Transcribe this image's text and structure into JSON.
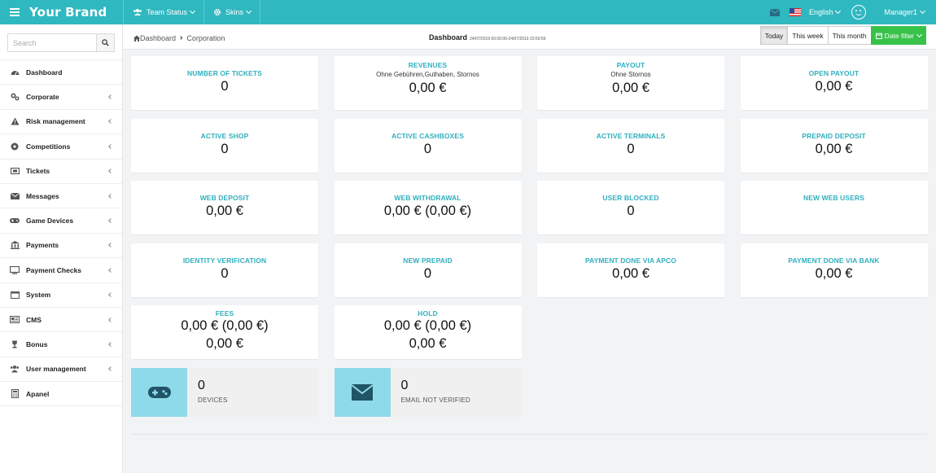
{
  "topbar": {
    "brand": "Your Brand",
    "menu": [
      {
        "label": "Team Status",
        "icon": "users-icon"
      },
      {
        "label": "Skins",
        "icon": "gear-icon"
      }
    ],
    "language": "English",
    "user": "Manager1"
  },
  "sidebar": {
    "search_placeholder": "Search",
    "items": [
      {
        "label": "Dashboard",
        "icon": "dashboard-icon",
        "has_children": false
      },
      {
        "label": "Corporate",
        "icon": "cogs-icon",
        "has_children": true
      },
      {
        "label": "Risk management",
        "icon": "warning-icon",
        "has_children": true
      },
      {
        "label": "Competitions",
        "icon": "ball-icon",
        "has_children": true
      },
      {
        "label": "Tickets",
        "icon": "ticket-icon",
        "has_children": true
      },
      {
        "label": "Messages",
        "icon": "envelope-icon",
        "has_children": true
      },
      {
        "label": "Game Devices",
        "icon": "gamepad-icon",
        "has_children": true
      },
      {
        "label": "Payments",
        "icon": "bank-icon",
        "has_children": true
      },
      {
        "label": "Payment Checks",
        "icon": "monitor-icon",
        "has_children": true
      },
      {
        "label": "System",
        "icon": "window-icon",
        "has_children": true
      },
      {
        "label": "CMS",
        "icon": "newspaper-icon",
        "has_children": true
      },
      {
        "label": "Bonus",
        "icon": "trophy-icon",
        "has_children": true
      },
      {
        "label": "User management",
        "icon": "users-icon",
        "has_children": true
      },
      {
        "label": "Apanel",
        "icon": "calculator-icon",
        "has_children": false
      }
    ]
  },
  "header": {
    "breadcrumb": [
      "Dashboard",
      "Corporation"
    ],
    "title": "Dashboard",
    "range": "24/07/2019 00:00:00-24/07/2019 23:59:59",
    "buttons": {
      "today": "Today",
      "week": "This week",
      "month": "This month",
      "filter": "Date filter"
    }
  },
  "cards": [
    {
      "title": "NUMBER OF TICKETS",
      "sub": "",
      "values": [
        "0"
      ]
    },
    {
      "title": "REVENUES",
      "sub": "Ohne Gebühren,Guthaben, Stornos",
      "values": [
        "0,00 €"
      ]
    },
    {
      "title": "PAYOUT",
      "sub": "Ohne Stornos",
      "values": [
        "0,00 €"
      ]
    },
    {
      "title": "OPEN PAYOUT",
      "sub": "",
      "values": [
        "0,00 €"
      ]
    },
    {
      "title": "ACTIVE SHOP",
      "sub": "",
      "values": [
        "0"
      ]
    },
    {
      "title": "ACTIVE CASHBOXES",
      "sub": "",
      "values": [
        "0"
      ]
    },
    {
      "title": "ACTIVE TERMINALS",
      "sub": "",
      "values": [
        "0"
      ]
    },
    {
      "title": "PREPAID DEPOSIT",
      "sub": "",
      "values": [
        "0,00 €"
      ]
    },
    {
      "title": "WEB DEPOSIT",
      "sub": "",
      "values": [
        "0,00 €"
      ]
    },
    {
      "title": "WEB WITHDRAWAL",
      "sub": "",
      "values": [
        "0,00 € (0,00 €)"
      ]
    },
    {
      "title": "USER BLOCKED",
      "sub": "",
      "values": [
        "0"
      ]
    },
    {
      "title": "NEW WEB USERS",
      "sub": "",
      "values": []
    },
    {
      "title": "IDENTITY VERIFICATION",
      "sub": "",
      "values": [
        "0"
      ]
    },
    {
      "title": "NEW PREPAID",
      "sub": "",
      "values": [
        "0"
      ]
    },
    {
      "title": "PAYMENT DONE VIA APCO",
      "sub": "",
      "values": [
        "0,00 €"
      ]
    },
    {
      "title": "PAYMENT DONE VIA BANK",
      "sub": "",
      "values": [
        "0,00 €"
      ]
    },
    {
      "title": "FEES",
      "sub": "",
      "values": [
        "0,00 € (0,00 €)",
        "0,00 €"
      ]
    },
    {
      "title": "HOLD",
      "sub": "",
      "values": [
        "0,00 € (0,00 €)",
        "0,00 €"
      ]
    }
  ],
  "info_boxes": [
    {
      "value": "0",
      "label": "DEVICES",
      "icon": "gamepad-icon"
    },
    {
      "value": "0",
      "label": "EMAIL NOT VERIFIED",
      "icon": "envelope-icon"
    }
  ],
  "colors": {
    "topbar": "#2fb8c0",
    "card_title": "#2fb0bf",
    "info_icon_bg": "#8fdaea",
    "filter_button": "#38c24a"
  }
}
